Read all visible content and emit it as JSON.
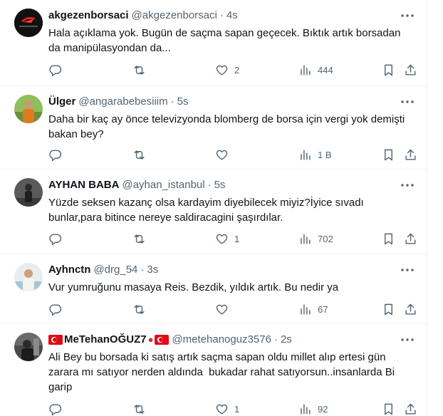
{
  "tweets": [
    {
      "name": "akgezenborsaci",
      "handle": "@akgezenborsaci",
      "sep": "·",
      "time": "4s",
      "text": "Hala açıklama yok. Bugün de saçma sapan geçecek. Bıktık artık borsadan da manipülasyondan da...",
      "avatar_text": "Akgezenborsaci",
      "replies": "",
      "retweets": "",
      "likes": "2",
      "views": "444"
    },
    {
      "name": "Ülger",
      "handle": "@angarabebesiiim",
      "sep": "·",
      "time": "5s",
      "text": "Daha bir kaç ay önce televizyonda blomberg de borsa için vergi yok demişti bakan bey?",
      "replies": "",
      "retweets": "",
      "likes": "",
      "views": "1 B"
    },
    {
      "name": "AYHAN BABA",
      "handle": "@ayhan_istanbul",
      "sep": "·",
      "time": "5s",
      "text": "Yüzde seksen kazanç olsa kardayim diyebilecek miyiz?İyice sıvadı bunlar,para bitince nereye saldiracagini şaşırdılar.",
      "replies": "",
      "retweets": "",
      "likes": "1",
      "views": "702"
    },
    {
      "name": "Ayhnctn",
      "handle": "@drg_54",
      "sep": "·",
      "time": "3s",
      "text": "Vur yumruğunu masaya Reis. Bezdik, yıldık artık. Bu nedir ya",
      "replies": "",
      "retweets": "",
      "likes": "",
      "views": "67"
    },
    {
      "name": "MeTehanOĞUZ7",
      "handle": "@metehanoguz3576",
      "sep": "·",
      "time": "2s",
      "text": "Ali Bey bu borsada ki satış artık saçma sapan oldu millet alıp ertesi gün zarara mı satıyor nerden aldında  bukadar rahat satıyorsun..insanlarda Bi garip",
      "replies": "",
      "retweets": "",
      "likes": "1",
      "views": "92"
    }
  ],
  "colors": {
    "text_primary": "#0f1419",
    "text_secondary": "#536471",
    "divider": "#eff3f4",
    "flag_red": "#e30a17"
  },
  "icons": {
    "reply": "reply-icon",
    "retweet": "retweet-icon",
    "like": "heart-icon",
    "views": "analytics-icon",
    "bookmark": "bookmark-icon",
    "share": "share-icon",
    "more": "more-icon"
  }
}
